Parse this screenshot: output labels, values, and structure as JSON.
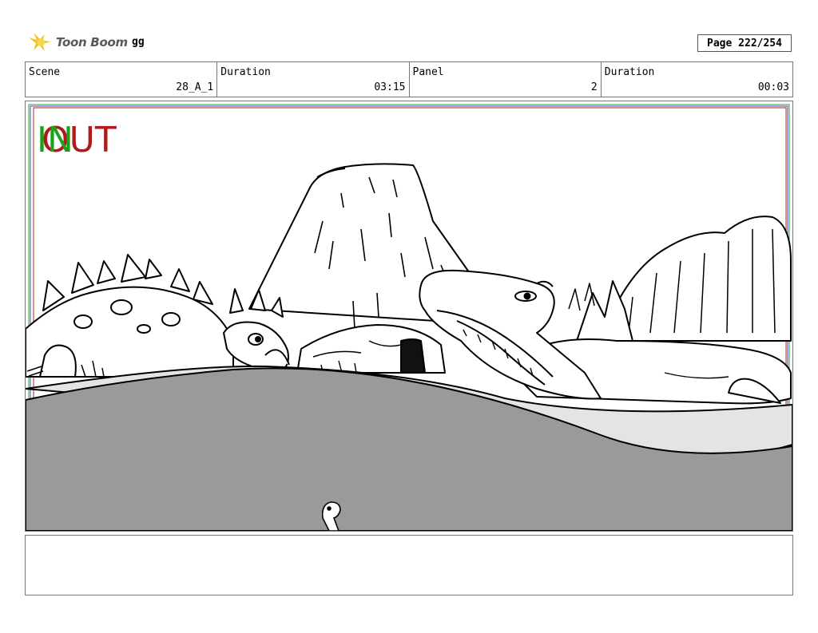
{
  "header": {
    "logo_text": "Toon Boom",
    "project_name": "gg",
    "page_label": "Page 222/254"
  },
  "info": {
    "scene_label": "Scene",
    "scene_value": "28_A_1",
    "duration_label": "Duration",
    "duration_value": "03:15",
    "panel_label": "Panel",
    "panel_value": "2",
    "panel_duration_label": "Duration",
    "panel_duration_value": "00:03"
  },
  "panel": {
    "in_marker": "IN",
    "out_marker": "OUT",
    "in_color": "#1aa31a",
    "out_color": "#b01a1a",
    "ground_color": "#9a9a9a"
  },
  "notes": {
    "text": ""
  }
}
